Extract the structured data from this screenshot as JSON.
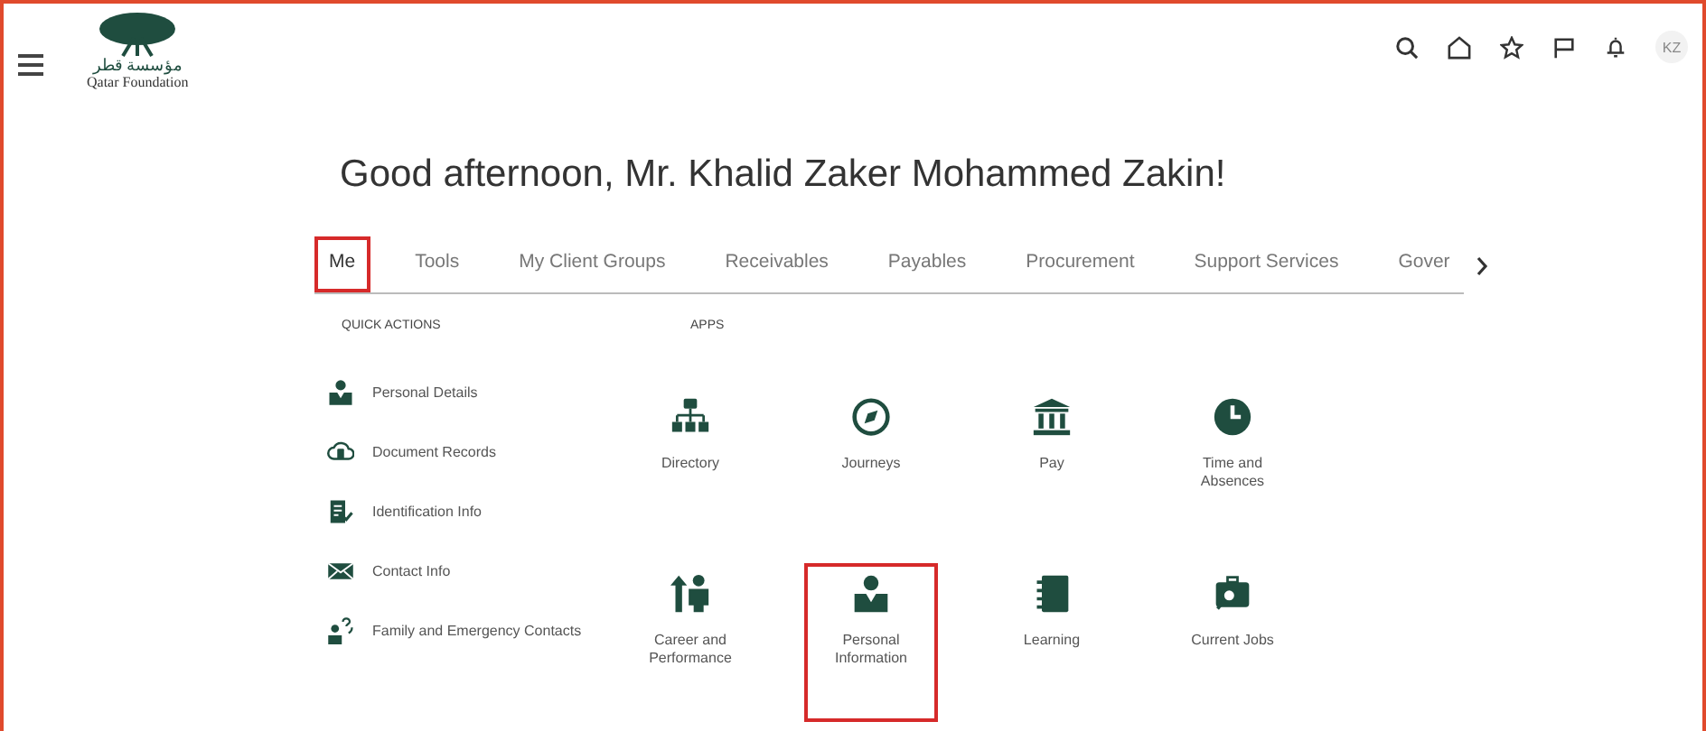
{
  "header": {
    "logo_arabic": "مؤسسة قطر",
    "logo_text": "Qatar Foundation",
    "avatar": "KZ"
  },
  "greeting": "Good afternoon, Mr. Khalid Zaker Mohammed Zakin!",
  "tabs": [
    {
      "label": "Me",
      "selected": true,
      "highlighted": true
    },
    {
      "label": "Tools",
      "selected": false,
      "highlighted": false
    },
    {
      "label": "My Client Groups",
      "selected": false,
      "highlighted": false
    },
    {
      "label": "Receivables",
      "selected": false,
      "highlighted": false
    },
    {
      "label": "Payables",
      "selected": false,
      "highlighted": false
    },
    {
      "label": "Procurement",
      "selected": false,
      "highlighted": false
    },
    {
      "label": "Support Services",
      "selected": false,
      "highlighted": false
    },
    {
      "label": "Gover",
      "selected": false,
      "highlighted": false
    }
  ],
  "quick_actions": {
    "title": "QUICK ACTIONS",
    "items": [
      {
        "label": "Personal Details",
        "kind": "person"
      },
      {
        "label": "Document Records",
        "kind": "cloud"
      },
      {
        "label": "Identification Info",
        "kind": "idcard"
      },
      {
        "label": "Contact Info",
        "kind": "mail"
      },
      {
        "label": "Family and Emergency Contacts",
        "kind": "family"
      }
    ]
  },
  "apps": {
    "title": "APPS",
    "items": [
      {
        "label": "Directory",
        "kind": "org",
        "highlighted": false
      },
      {
        "label": "Journeys",
        "kind": "compass",
        "highlighted": false
      },
      {
        "label": "Pay",
        "kind": "bank",
        "highlighted": false
      },
      {
        "label": "Time and Absences",
        "kind": "clock",
        "highlighted": false
      },
      {
        "label": "Career and Performance",
        "kind": "career",
        "highlighted": false
      },
      {
        "label": "Personal Information",
        "kind": "person",
        "highlighted": true
      },
      {
        "label": "Learning",
        "kind": "book",
        "highlighted": false
      },
      {
        "label": "Current Jobs",
        "kind": "jobs",
        "highlighted": false
      }
    ]
  }
}
